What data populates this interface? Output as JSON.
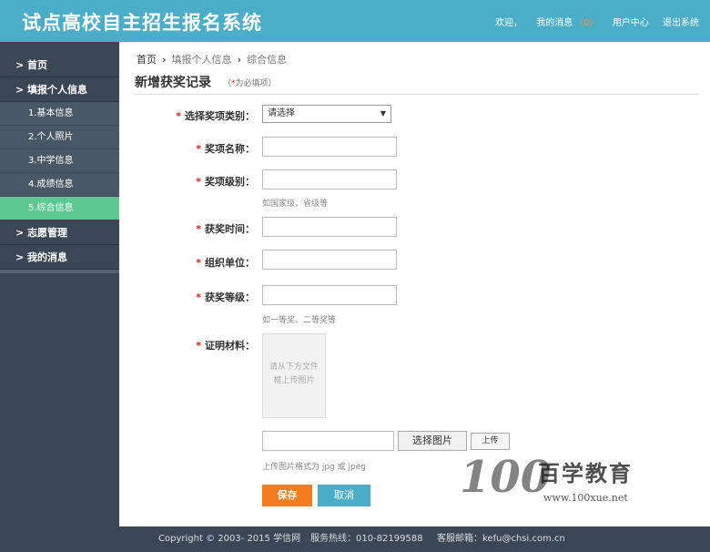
{
  "header": {
    "title": "试点高校自主招生报名系统",
    "welcome": "欢迎，",
    "messages_label": "我的消息",
    "messages_count": "（0）",
    "user_center": "用户中心",
    "logout": "退出系统"
  },
  "sidebar": {
    "home": "> 首页",
    "apply": "> 填报个人信息",
    "subs": [
      "1.基本信息",
      "2.个人照片",
      "3.中学信息",
      "4.成绩信息",
      "5.综合信息"
    ],
    "volunteer": "> 志愿管理",
    "messages": "> 我的消息"
  },
  "breadcrumb": [
    "首页",
    "填报个人信息",
    "综合信息"
  ],
  "page": {
    "title": "新增获奖记录",
    "note_open": "（",
    "note_star": "*",
    "note_text": "为必填项）"
  },
  "form": {
    "award_type_label": "选择奖项类别：",
    "award_type_value": "请选择",
    "award_name_label": "奖项名称：",
    "award_level_label": "奖项级别：",
    "award_level_hint": "如国家级、省级等",
    "award_time_label": "获奖时间：",
    "organizer_label": "组织单位：",
    "award_grade_label": "获奖等级：",
    "award_grade_hint": "如一等奖、二等奖等",
    "proof_label": "证明材料：",
    "preview_line1": "请从下方文件",
    "preview_line2": "框上传图片",
    "choose_button": "选择图片",
    "upload_button": "上传",
    "format_hint": "上传图片格式为 jpg 或 jpeg",
    "required_star": "*",
    "select_arrow": "▼"
  },
  "actions": {
    "save": "保存",
    "cancel": "取消"
  },
  "footer": {
    "copyright": "Copyright © 2003- 2015 学信网",
    "hotline": "服务热线：010-82199588",
    "email": "客服邮箱：kefu@chsi.com.cn"
  },
  "watermark": {
    "numbers": "100",
    "name": "百学教育",
    "url": "www.100xue.net"
  },
  "colors": {
    "header": "#4aaec8",
    "sidebar": "#3b4755",
    "active": "#5cc894",
    "save": "#f47c1c",
    "cancel": "#4aaec8"
  }
}
